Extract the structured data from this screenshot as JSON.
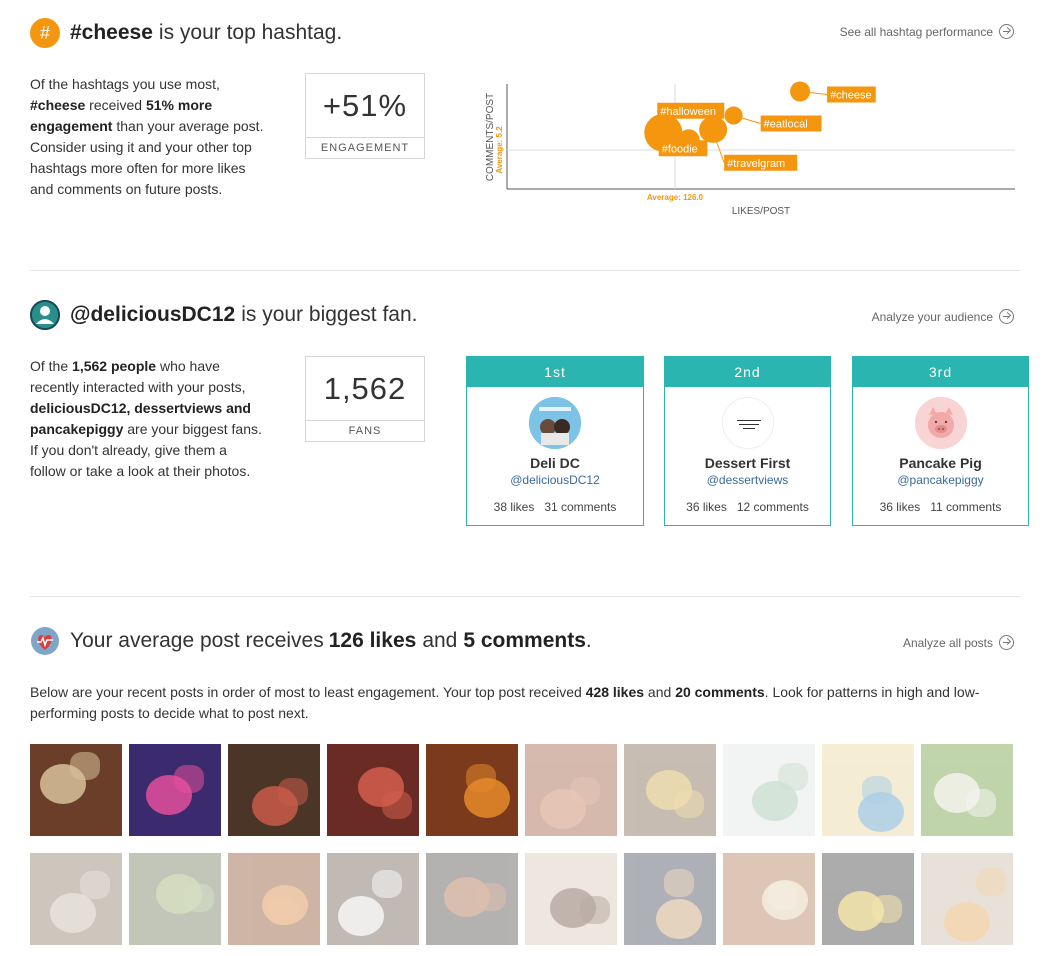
{
  "hashtag": {
    "tag": "#cheese",
    "heading_rest": "is your top hashtag.",
    "link_label": "See all hashtag performance",
    "desc_parts": [
      "Of the hashtags you use most, ",
      "#cheese",
      " received ",
      "51% more engagement",
      " than your average post. Consider using it and your other top hashtags more often for more likes and comments on future posts."
    ],
    "stat_value": "+51%",
    "stat_label": "ENGAGEMENT",
    "colors": {
      "accent": "#f5960f",
      "icon_bg": "#f5960f"
    },
    "icon": "hash-icon"
  },
  "chart_data": {
    "type": "scatter",
    "xlabel": "LIKES/POST",
    "ylabel": "COMMENTS/POST",
    "x_average_label": "Average: 126.0",
    "y_average_label": "Average: 5.2",
    "x_average": 126.0,
    "y_average": 5.2,
    "xlim": [
      40,
      300
    ],
    "ylim": [
      0,
      14
    ],
    "points": [
      {
        "label": "#cheese",
        "x": 190,
        "y": 13,
        "size": 10
      },
      {
        "label": "#eatlocal",
        "x": 156,
        "y": 9.8,
        "size": 9
      },
      {
        "label": "#halloween",
        "x": 120,
        "y": 7.5,
        "size": 19
      },
      {
        "label": "#foodie",
        "x": 133,
        "y": 6.5,
        "size": 11
      },
      {
        "label": "#travelgram",
        "x": 145,
        "y": 7.9,
        "size": 13
      },
      {
        "label": "",
        "x": 146,
        "y": 7.9,
        "size": 13
      }
    ],
    "color": "#f5960f",
    "grid": false
  },
  "fans": {
    "handle": "@deliciousDC12",
    "heading_rest": "is your biggest fan.",
    "link_label": "Analyze your audience",
    "desc_parts": [
      "Of the ",
      "1,562 people",
      " who have recently interacted with your posts, ",
      "deliciousDC12, dessertviews and pancakepiggy",
      " are your biggest fans. If you don't already, give them a follow or take a look at their photos."
    ],
    "stat_value": "1,562",
    "stat_label": "FANS",
    "icon": "user-icon",
    "top": [
      {
        "rank": "1st",
        "name": "Deli DC",
        "handle": "@deliciousDC12",
        "likes": "38 likes",
        "comments": "31 comments"
      },
      {
        "rank": "2nd",
        "name": "Dessert First",
        "handle": "@dessertviews",
        "likes": "36 likes",
        "comments": "12 comments"
      },
      {
        "rank": "3rd",
        "name": "Pancake Pig",
        "handle": "@pancakepiggy",
        "likes": "36 likes",
        "comments": "11 comments"
      }
    ],
    "colors": {
      "accent": "#2bb5b0"
    }
  },
  "posts": {
    "heading_parts": [
      "Your average post receives ",
      "126 likes",
      " and ",
      "5 comments",
      "."
    ],
    "link_label": "Analyze all posts",
    "desc_parts": [
      "Below are your recent posts in order of most to least engagement. Your top post received ",
      "428 likes",
      " and ",
      "20 comments",
      ". Look for patterns in high and low-performing posts to decide what to post next."
    ],
    "icon": "heart-pulse-icon",
    "thumbs": [
      {
        "name": "post-thumb-1",
        "bg": "#6b3e2a",
        "accent": "#d8c19a",
        "faded": false
      },
      {
        "name": "post-thumb-2",
        "bg": "#3b2a6e",
        "accent": "#e34f9b",
        "faded": false
      },
      {
        "name": "post-thumb-3",
        "bg": "#4b3526",
        "accent": "#c95b4a",
        "faded": false
      },
      {
        "name": "post-thumb-4",
        "bg": "#6a2b24",
        "accent": "#d25e4d",
        "faded": false
      },
      {
        "name": "post-thumb-5",
        "bg": "#7a3a1b",
        "accent": "#e6892a",
        "faded": false
      },
      {
        "name": "post-thumb-6",
        "bg": "#9b5a3c",
        "accent": "#c47a55",
        "faded": true
      },
      {
        "name": "post-thumb-7",
        "bg": "#7a6248",
        "accent": "#d8b045",
        "faded": true
      },
      {
        "name": "post-thumb-8",
        "bg": "#dfe6e2",
        "accent": "#8fb89a",
        "faded": true
      },
      {
        "name": "post-thumb-9",
        "bg": "#e9d49a",
        "accent": "#3d8fc7",
        "faded": true
      },
      {
        "name": "post-thumb-10",
        "bg": "#6b9a3a",
        "accent": "#e4e4d8",
        "faded": true
      },
      {
        "name": "post-thumb-11",
        "bg": "#8a7864",
        "accent": "#c9c0a8",
        "faded": true
      },
      {
        "name": "post-thumb-12",
        "bg": "#6e7a5a",
        "accent": "#9fb070",
        "faded": true
      },
      {
        "name": "post-thumb-13",
        "bg": "#8a4e2c",
        "accent": "#e08a3a",
        "faded": true
      },
      {
        "name": "post-thumb-14",
        "bg": "#6a5a4e",
        "accent": "#ececec",
        "faded": true
      },
      {
        "name": "post-thumb-15",
        "bg": "#4e4a46",
        "accent": "#b06a40",
        "faded": true
      },
      {
        "name": "post-thumb-16",
        "bg": "#d8c8b4",
        "accent": "#5a3a28",
        "faded": true
      },
      {
        "name": "post-thumb-17",
        "bg": "#3e4656",
        "accent": "#d8a66a",
        "faded": true
      },
      {
        "name": "post-thumb-18",
        "bg": "#b07a52",
        "accent": "#e8d8b8",
        "faded": true
      },
      {
        "name": "post-thumb-19",
        "bg": "#3a3a3a",
        "accent": "#e8c23a",
        "faded": true
      },
      {
        "name": "post-thumb-20",
        "bg": "#c8b8a8",
        "accent": "#e8a04a",
        "faded": true
      }
    ]
  }
}
